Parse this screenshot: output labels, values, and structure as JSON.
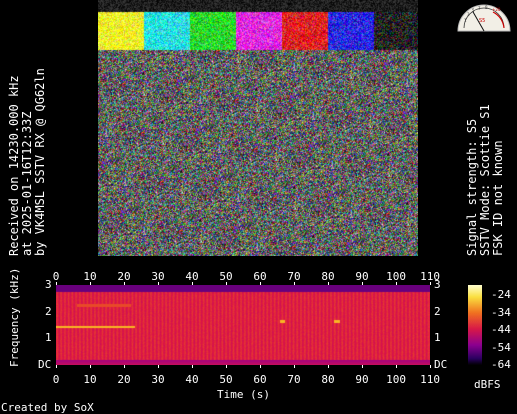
{
  "caption_left": {
    "line1": "Received on  14230.000 kHz",
    "line2": "at 2025-01-16T12:33Z",
    "line3": "by VK4MSL SSTV RX @ QG62ln"
  },
  "caption_right": {
    "line1": "Signal strength: S5",
    "line2": "SSTV Mode: Scottie S1",
    "line3": "FSK ID not known"
  },
  "s_meter": {
    "reading": "S5"
  },
  "spectrogram": {
    "x_ticks": [
      "0",
      "10",
      "20",
      "30",
      "40",
      "50",
      "60",
      "70",
      "80",
      "90",
      "100",
      "110"
    ],
    "y_ticks": [
      "3",
      "2",
      "1",
      "DC"
    ],
    "xlabel": "Time (s)",
    "ylabel": "Frequency (kHz)"
  },
  "colorbar": {
    "ticks": [
      "-24",
      "-34",
      "-44",
      "-54",
      "-64"
    ],
    "unit": "dBFS"
  },
  "footer": "Created by SoX",
  "colors": {
    "background": "#000000",
    "text": "#ffffff"
  }
}
